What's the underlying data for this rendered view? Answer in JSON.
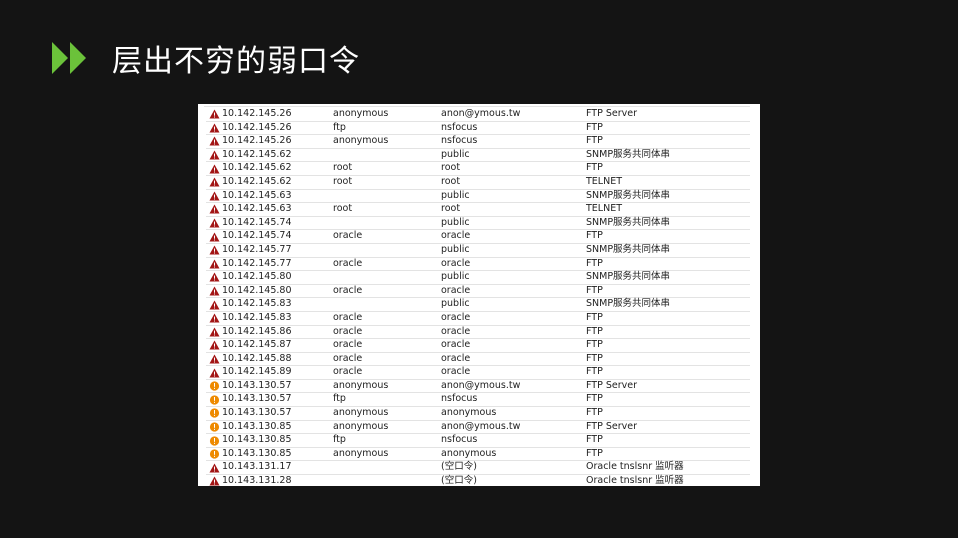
{
  "slide": {
    "title": "层出不穷的弱口令",
    "accent_color": "#6bc23a",
    "title_icon": "double-play-icon"
  },
  "table": {
    "icons": {
      "high": "warning-triangle-icon",
      "medium": "warning-circle-icon"
    },
    "colors": {
      "high": "#a31515",
      "medium": "#ee8a00"
    },
    "rows": [
      {
        "risk": "high",
        "ip": "10.142.145.26",
        "user": "anonymous",
        "pass": "anon@ymous.tw",
        "service": "FTP Server"
      },
      {
        "risk": "high",
        "ip": "10.142.145.26",
        "user": "ftp",
        "pass": "nsfocus",
        "service": "FTP"
      },
      {
        "risk": "high",
        "ip": "10.142.145.26",
        "user": "anonymous",
        "pass": "nsfocus",
        "service": "FTP"
      },
      {
        "risk": "high",
        "ip": "10.142.145.62",
        "user": "",
        "pass": "public",
        "service": "SNMP服务共同体串"
      },
      {
        "risk": "high",
        "ip": "10.142.145.62",
        "user": "root",
        "pass": "root",
        "service": "FTP"
      },
      {
        "risk": "high",
        "ip": "10.142.145.62",
        "user": "root",
        "pass": "root",
        "service": "TELNET"
      },
      {
        "risk": "high",
        "ip": "10.142.145.63",
        "user": "",
        "pass": "public",
        "service": "SNMP服务共同体串"
      },
      {
        "risk": "high",
        "ip": "10.142.145.63",
        "user": "root",
        "pass": "root",
        "service": "TELNET"
      },
      {
        "risk": "high",
        "ip": "10.142.145.74",
        "user": "",
        "pass": "public",
        "service": "SNMP服务共同体串"
      },
      {
        "risk": "high",
        "ip": "10.142.145.74",
        "user": "oracle",
        "pass": "oracle",
        "service": "FTP"
      },
      {
        "risk": "high",
        "ip": "10.142.145.77",
        "user": "",
        "pass": "public",
        "service": "SNMP服务共同体串"
      },
      {
        "risk": "high",
        "ip": "10.142.145.77",
        "user": "oracle",
        "pass": "oracle",
        "service": "FTP"
      },
      {
        "risk": "high",
        "ip": "10.142.145.80",
        "user": "",
        "pass": "public",
        "service": "SNMP服务共同体串"
      },
      {
        "risk": "high",
        "ip": "10.142.145.80",
        "user": "oracle",
        "pass": "oracle",
        "service": "FTP"
      },
      {
        "risk": "high",
        "ip": "10.142.145.83",
        "user": "",
        "pass": "public",
        "service": "SNMP服务共同体串"
      },
      {
        "risk": "high",
        "ip": "10.142.145.83",
        "user": "oracle",
        "pass": "oracle",
        "service": "FTP"
      },
      {
        "risk": "high",
        "ip": "10.142.145.86",
        "user": "oracle",
        "pass": "oracle",
        "service": "FTP"
      },
      {
        "risk": "high",
        "ip": "10.142.145.87",
        "user": "oracle",
        "pass": "oracle",
        "service": "FTP"
      },
      {
        "risk": "high",
        "ip": "10.142.145.88",
        "user": "oracle",
        "pass": "oracle",
        "service": "FTP"
      },
      {
        "risk": "high",
        "ip": "10.142.145.89",
        "user": "oracle",
        "pass": "oracle",
        "service": "FTP"
      },
      {
        "risk": "medium",
        "ip": "10.143.130.57",
        "user": "anonymous",
        "pass": "anon@ymous.tw",
        "service": "FTP Server"
      },
      {
        "risk": "medium",
        "ip": "10.143.130.57",
        "user": "ftp",
        "pass": "nsfocus",
        "service": "FTP"
      },
      {
        "risk": "medium",
        "ip": "10.143.130.57",
        "user": "anonymous",
        "pass": "anonymous",
        "service": "FTP"
      },
      {
        "risk": "medium",
        "ip": "10.143.130.85",
        "user": "anonymous",
        "pass": "anon@ymous.tw",
        "service": "FTP Server"
      },
      {
        "risk": "medium",
        "ip": "10.143.130.85",
        "user": "ftp",
        "pass": "nsfocus",
        "service": "FTP"
      },
      {
        "risk": "medium",
        "ip": "10.143.130.85",
        "user": "anonymous",
        "pass": "anonymous",
        "service": "FTP"
      },
      {
        "risk": "high",
        "ip": "10.143.131.17",
        "user": "",
        "pass": "(空口令)",
        "service": "Oracle tnslsnr 监听器"
      },
      {
        "risk": "high",
        "ip": "10.143.131.28",
        "user": "",
        "pass": "(空口令)",
        "service": "Oracle tnslsnr 监听器"
      }
    ]
  }
}
